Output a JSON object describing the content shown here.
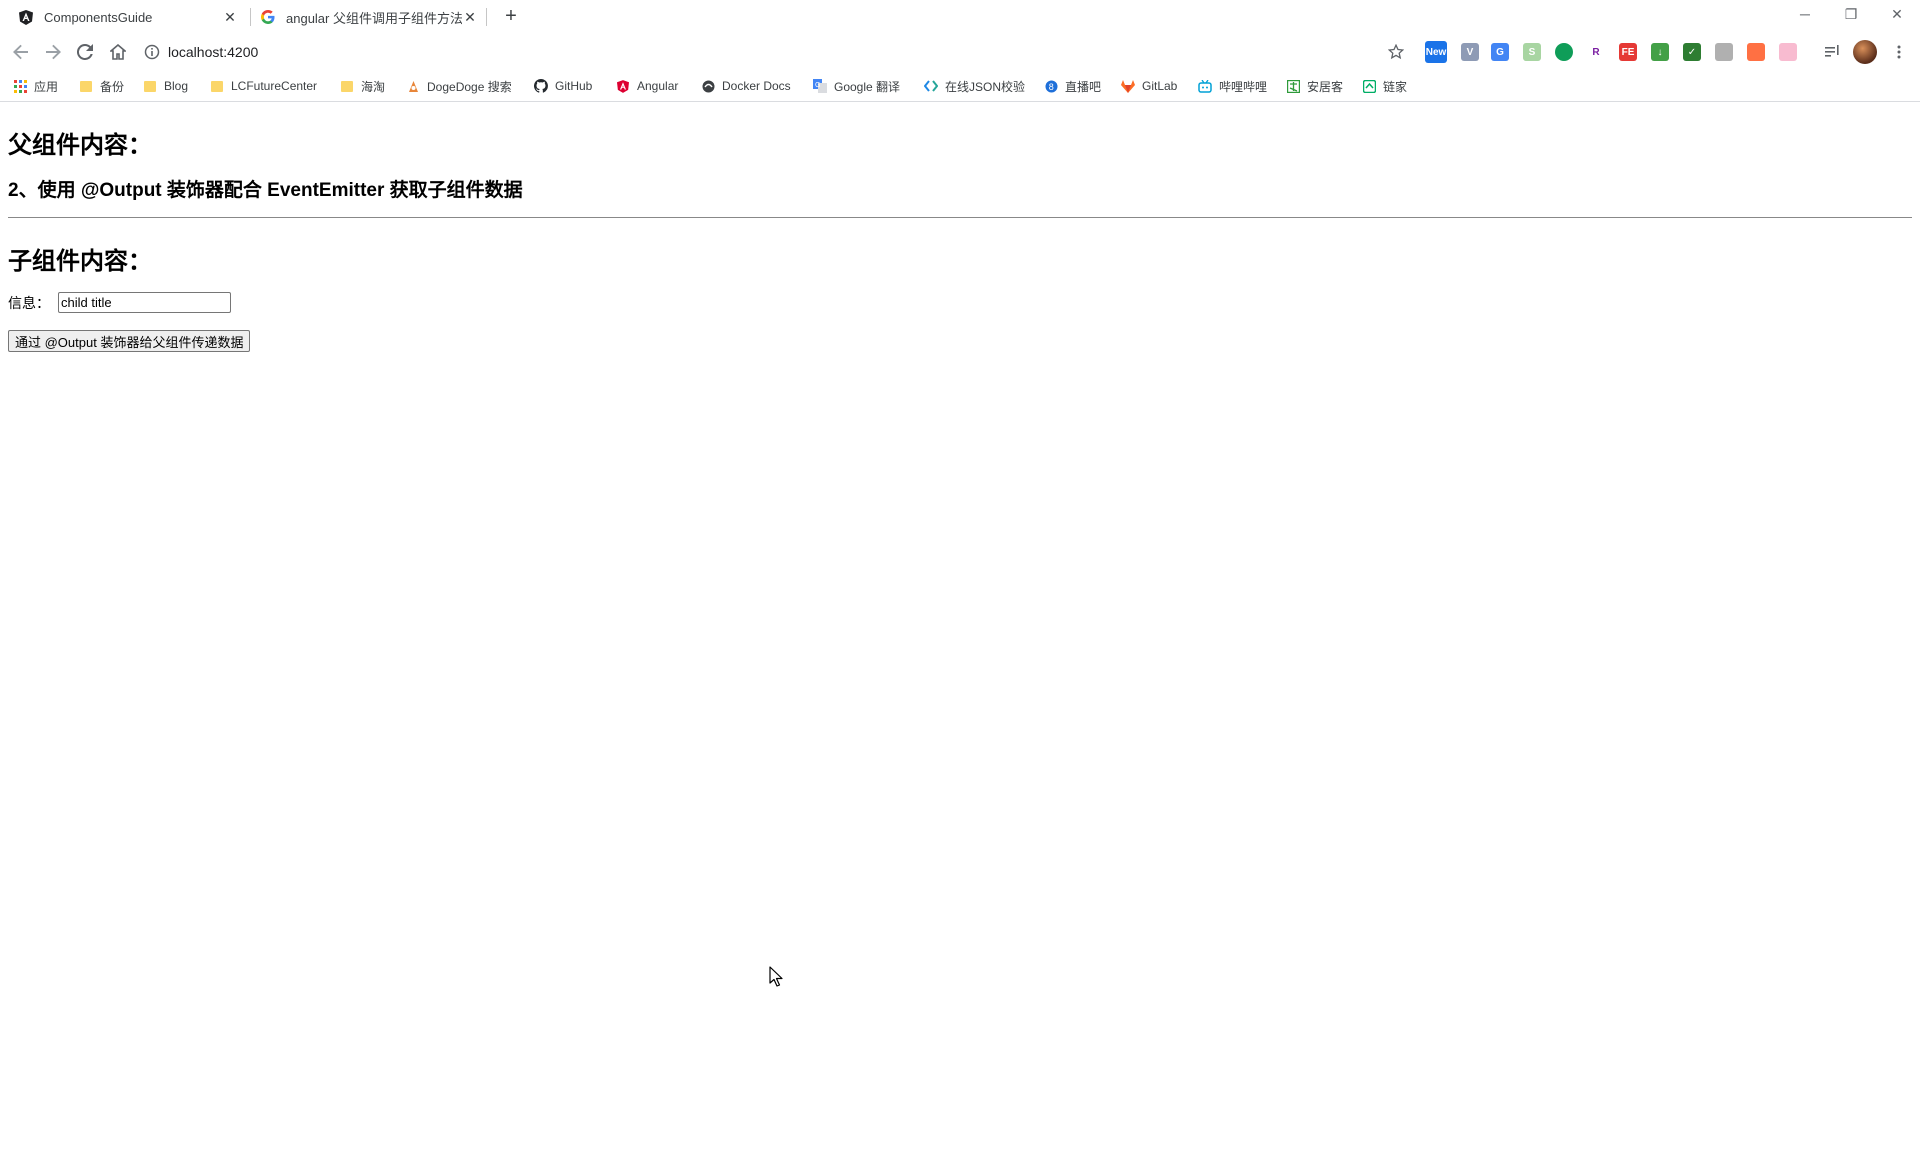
{
  "browser": {
    "tabs": [
      {
        "title": "ComponentsGuide",
        "icon": "angular-icon",
        "active": true
      },
      {
        "title": "angular 父组件调用子组件方法（",
        "icon": "google-icon",
        "active": false
      }
    ],
    "new_tab": "+",
    "window_controls": {
      "minimize": "─",
      "restore": "❐",
      "close": "✕"
    },
    "url": "localhost:4200",
    "colors": {
      "accent": "#1a73e8",
      "folder": "#fbd669"
    }
  },
  "bookmarks": [
    {
      "label": "应用",
      "icon": "apps-grid-icon"
    },
    {
      "label": "备份",
      "icon": "folder-icon"
    },
    {
      "label": "Blog",
      "icon": "folder-icon"
    },
    {
      "label": "LCFutureCenter",
      "icon": "folder-icon"
    },
    {
      "label": "海淘",
      "icon": "folder-icon"
    },
    {
      "label": "DogeDoge 搜索",
      "icon": "dogedoge-icon"
    },
    {
      "label": "GitHub",
      "icon": "github-icon"
    },
    {
      "label": "Angular",
      "icon": "angular-icon"
    },
    {
      "label": "Docker Docs",
      "icon": "docker-icon"
    },
    {
      "label": "Google 翻译",
      "icon": "google-translate-icon"
    },
    {
      "label": "在线JSON校验",
      "icon": "json-icon"
    },
    {
      "label": "直播吧",
      "icon": "zhibo8-icon"
    },
    {
      "label": "GitLab",
      "icon": "gitlab-icon"
    },
    {
      "label": "哔哩哔哩",
      "icon": "bilibili-icon"
    },
    {
      "label": "安居客",
      "icon": "anjuke-icon"
    },
    {
      "label": "链家",
      "icon": "lianjia-icon"
    }
  ],
  "page": {
    "parent_heading": "父组件内容：",
    "parent_subheading": "2、使用 @Output 装饰器配合 EventEmitter 获取子组件数据",
    "child_heading": "子组件内容：",
    "info_label": "信息：",
    "info_value": "child title",
    "emit_button": "通过 @Output 装饰器给父组件传递数据"
  }
}
